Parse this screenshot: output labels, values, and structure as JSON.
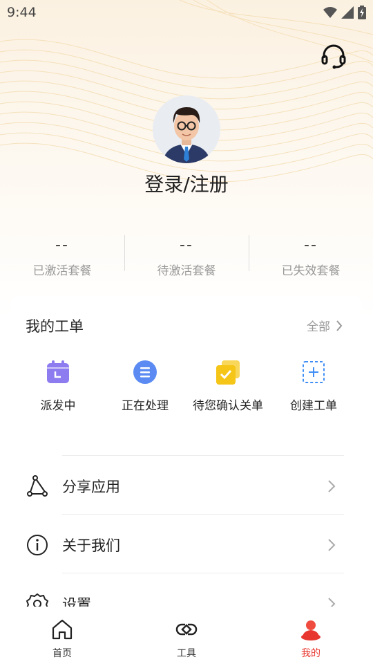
{
  "status_bar": {
    "time": "9:44",
    "icons": [
      "wifi-icon",
      "signal-icon",
      "battery-charging-icon"
    ]
  },
  "header": {
    "support_icon": "headset-icon"
  },
  "profile": {
    "avatar": "avatar-man-with-glasses",
    "login_text": "登录/注册"
  },
  "stats": [
    {
      "value": "--",
      "label": "已激活套餐"
    },
    {
      "value": "--",
      "label": "待激活套餐"
    },
    {
      "value": "--",
      "label": "已失效套餐"
    }
  ],
  "orders": {
    "title": "我的工单",
    "all_label": "全部",
    "items": [
      {
        "label": "派发中",
        "icon": "calendar-icon",
        "color": "#8c7cf0"
      },
      {
        "label": "正在处理",
        "icon": "list-icon",
        "color": "#5b8bf2"
      },
      {
        "label": "待您确认关单",
        "icon": "check-icon",
        "color": "#f5c518"
      },
      {
        "label": "创建工单",
        "icon": "plus-icon",
        "color": "#3f8ef5"
      }
    ]
  },
  "menu": [
    {
      "label": "分享应用",
      "icon": "share-icon"
    },
    {
      "label": "关于我们",
      "icon": "info-icon"
    },
    {
      "label": "设置",
      "icon": "gear-icon"
    }
  ],
  "tabs": [
    {
      "label": "首页",
      "icon": "home-icon",
      "active": false
    },
    {
      "label": "工具",
      "icon": "tools-icon",
      "active": false
    },
    {
      "label": "我的",
      "icon": "user-icon",
      "active": true
    }
  ],
  "colors": {
    "accent": "#e8372f",
    "text_secondary": "#999999"
  }
}
